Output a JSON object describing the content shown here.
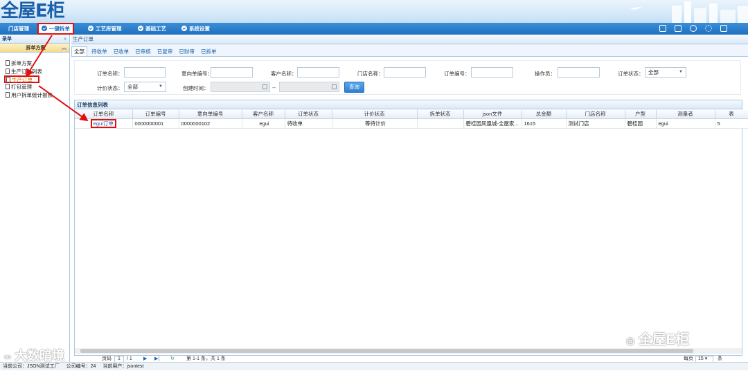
{
  "header": {
    "logo": "全屋E柜"
  },
  "nav": {
    "items": [
      {
        "label": "门店管理"
      },
      {
        "label": "一键拆单"
      },
      {
        "label": "工艺库管理"
      },
      {
        "label": "基础工艺"
      },
      {
        "label": "系统设置"
      }
    ],
    "tool_icons": [
      "home-icon",
      "calendar-icon",
      "user-icon",
      "gear-icon",
      "exit-icon"
    ]
  },
  "sidebar": {
    "title": "录单",
    "section": "拆单方案",
    "items": [
      {
        "label": "拆单方案"
      },
      {
        "label": "生产订单列表"
      },
      {
        "label": "生产订单"
      },
      {
        "label": "打包管理"
      },
      {
        "label": "用户拆单统计报表"
      }
    ]
  },
  "main": {
    "breadcrumb": "生产订单",
    "tabs": [
      "全部",
      "待收单",
      "已收单",
      "已审核",
      "已复审",
      "已财审",
      "已拆单"
    ],
    "search": {
      "order_name": "订单名称：",
      "intent_no": "意向单编号：",
      "customer": "客户名称：",
      "store": "门店名称：",
      "order_no": "订单编号：",
      "operator": "操作员：",
      "order_status": "订单状态：",
      "order_status_value": "全部",
      "price_status": "计价状态：",
      "price_status_value": "全部",
      "created": "创建时间：",
      "date_sep": "--",
      "query": "查询"
    },
    "grid": {
      "title": "订单信息列表",
      "columns": [
        "订单名称",
        "订单编号",
        "意向单编号",
        "客户名称",
        "订单状态",
        "计价状态",
        "拆单状态",
        "json文件",
        "总金额",
        "门店名称",
        "户型",
        "测量者",
        "表"
      ],
      "rows": [
        [
          "egui订单",
          "0000000001",
          "0000000102",
          "egui",
          "待收单",
          "等待计价",
          "",
          "碧桂园凤凰城-全屋家...",
          "1615",
          "测试门店",
          "碧桂园",
          "egui",
          "5"
        ]
      ]
    },
    "pager": {
      "page_label": "页码",
      "page": "1",
      "total_pages": "/ 1",
      "info": "第 1-1 条，共 1 条",
      "per_page_label": "每页",
      "per_page": "15",
      "per_page_suffix": "条"
    }
  },
  "status": {
    "company": "当前公司：JSON测试工厂",
    "company_no": "公司编号：24",
    "user": "当前用户：jsontest"
  },
  "watermarks": {
    "left": "大数暗境",
    "right": "全屋E柜"
  }
}
